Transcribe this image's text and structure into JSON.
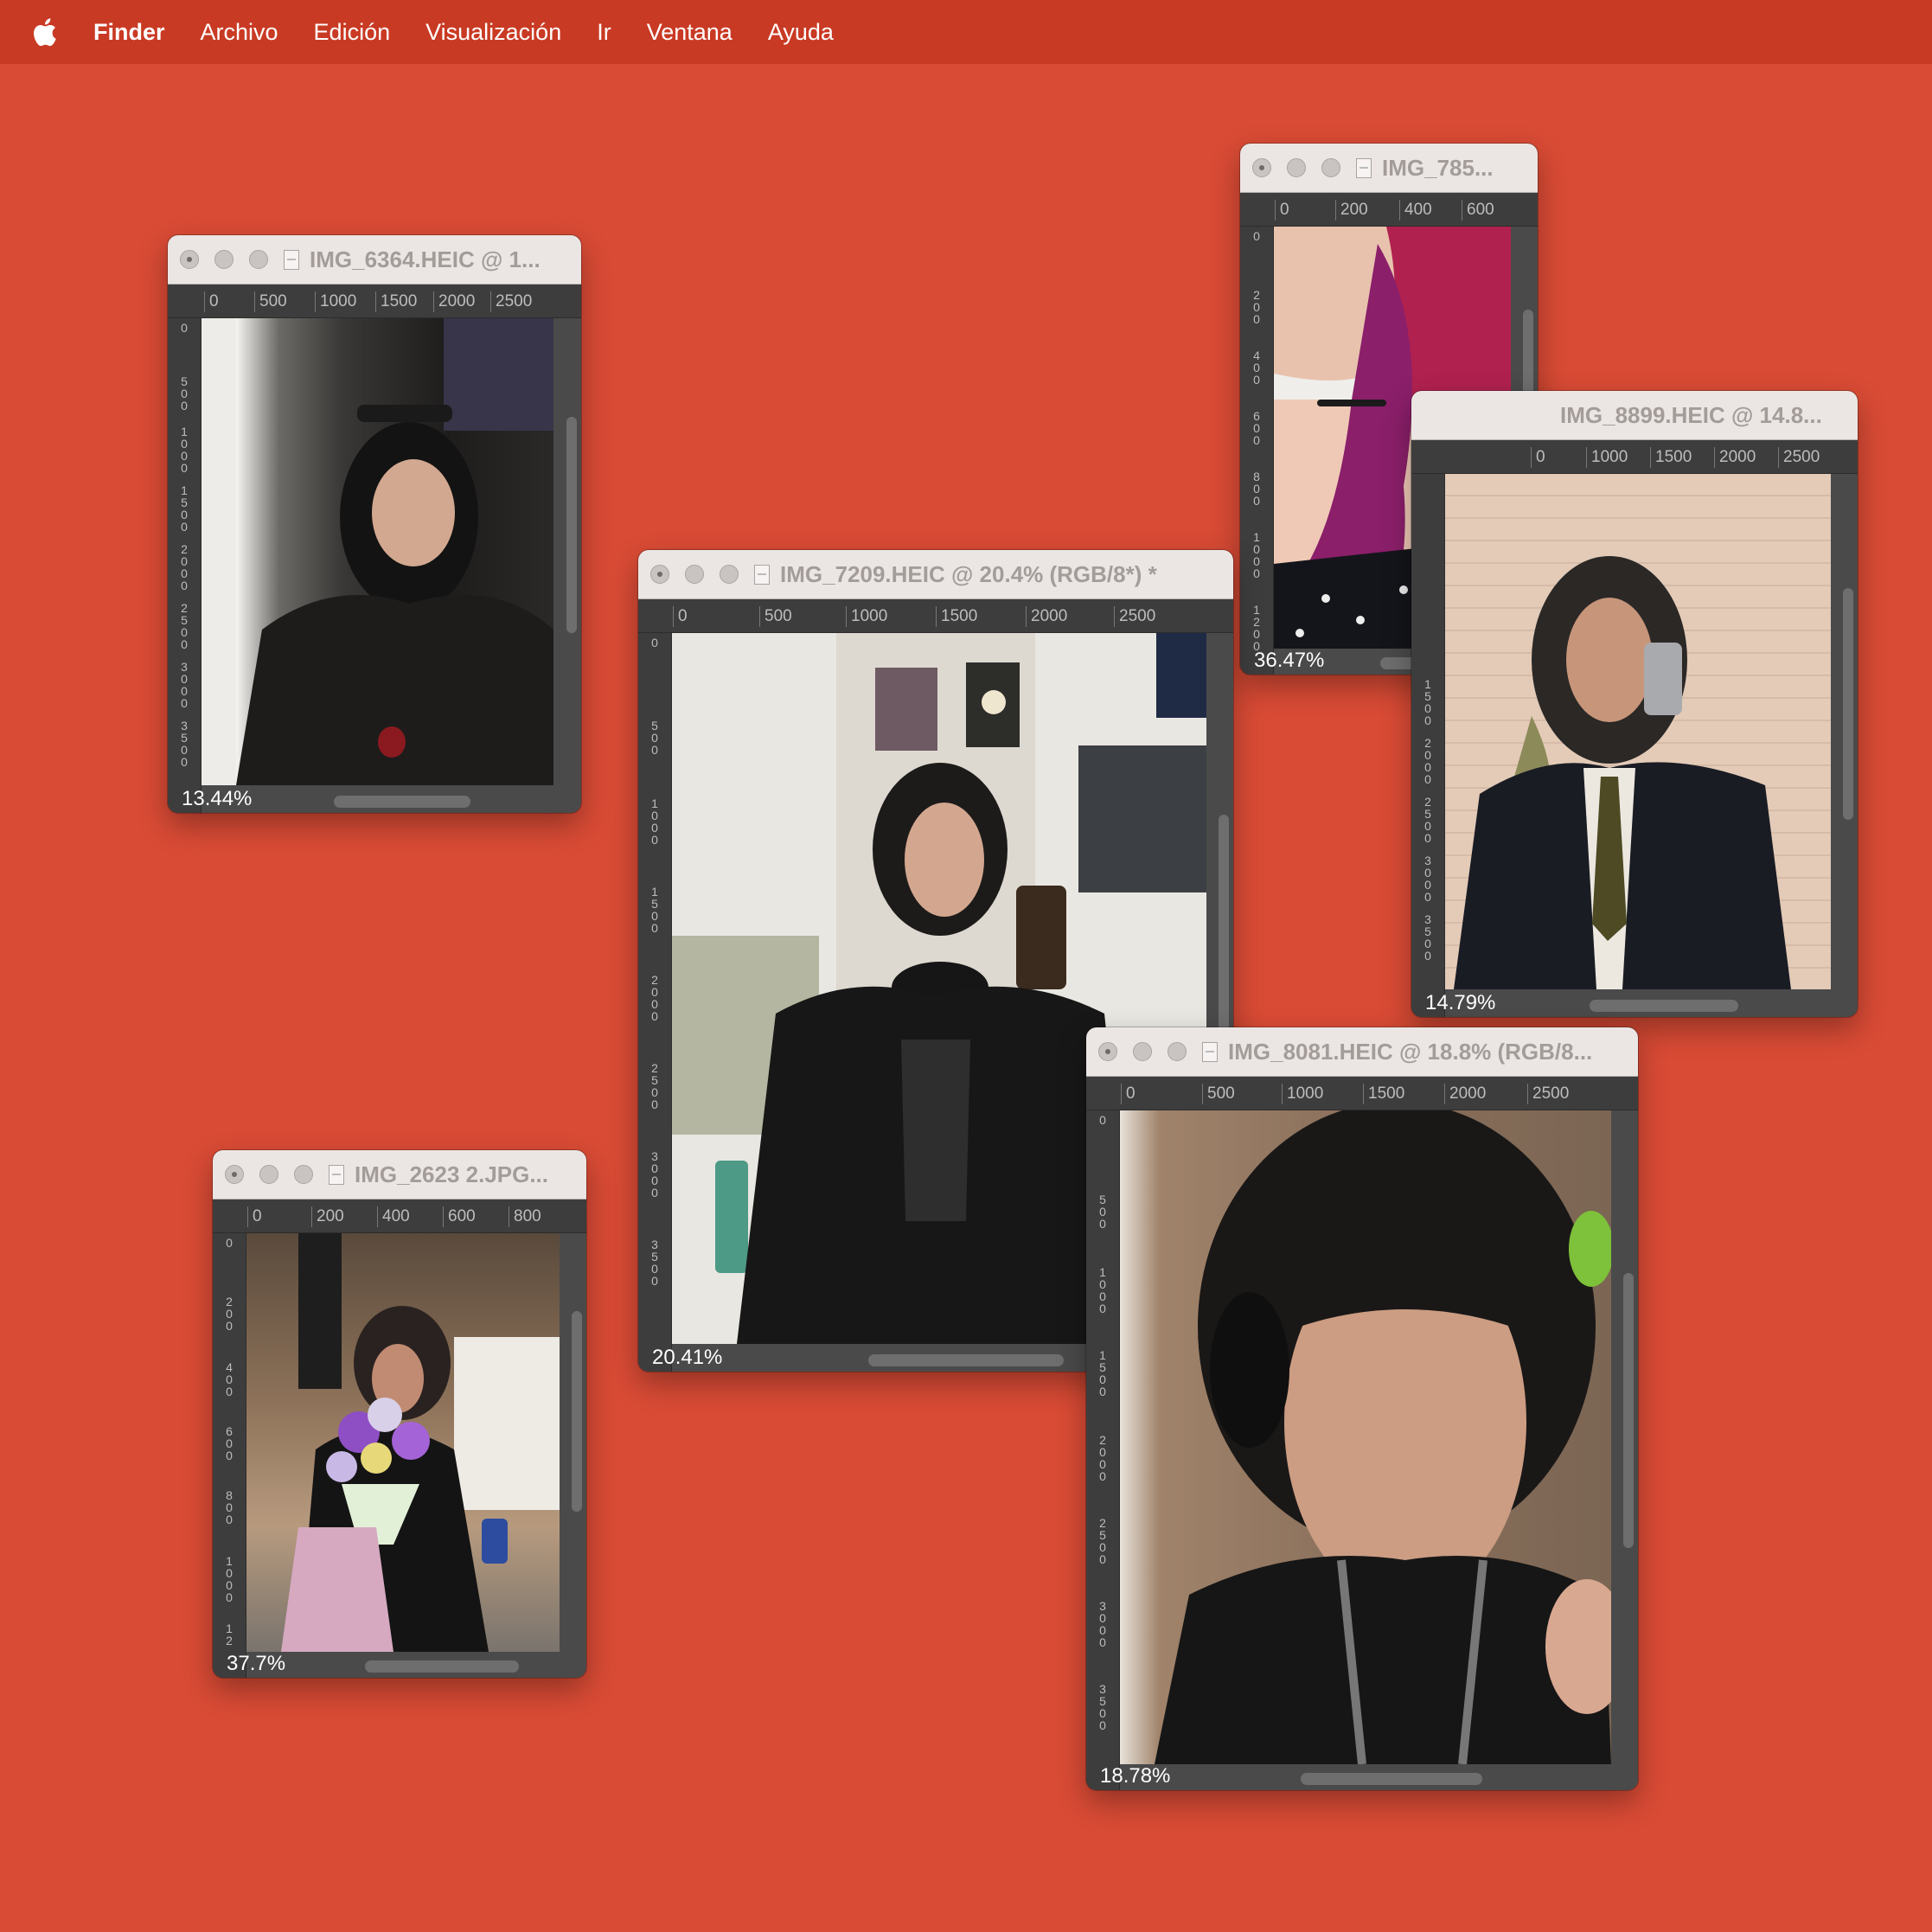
{
  "colors": {
    "desktop": "#d94b35",
    "menubar": "#c93a24",
    "window_chrome": "#4a4a4a",
    "titlebar": "#ebe6e4"
  },
  "menubar": {
    "icon": "apple-logo-icon",
    "app_name": "Finder",
    "items": [
      "Archivo",
      "Edición",
      "Visualización",
      "Ir",
      "Ventana",
      "Ayuda"
    ]
  },
  "windows": [
    {
      "title": "IMG_6364.HEIC @ 1...",
      "zoom": "13.44%",
      "ruler_x": [
        "0",
        "500",
        "1000",
        "1500",
        "2000",
        "2500"
      ],
      "ruler_y": [
        "0",
        "5\n0\n0",
        "1\n0\n0\n0",
        "1\n5\n0\n0",
        "2\n0\n0\n0",
        "2\n5\n0\n0",
        "3\n0\n0\n0",
        "3\n5\n0\n0"
      ]
    },
    {
      "title": "IMG_785...",
      "zoom": "36.47%",
      "ruler_x": [
        "0",
        "200",
        "400",
        "600"
      ],
      "ruler_y": [
        "0",
        "2\n0\n0",
        "4\n0\n0",
        "6\n0\n0",
        "8\n0\n0",
        "1\n0\n0\n0",
        "1\n2\n0\n0"
      ]
    },
    {
      "title": "IMG_8899.HEIC @ 14.8...",
      "zoom": "14.79%",
      "ruler_x": [
        "0",
        "1000",
        "1500",
        "2000",
        "2500"
      ],
      "ruler_y": [
        "1\n5\n0\n0",
        "2\n0\n0\n0",
        "2\n5\n0\n0",
        "3\n0\n0\n0",
        "3\n5\n0\n0"
      ]
    },
    {
      "title": "IMG_7209.HEIC @ 20.4% (RGB/8*) *",
      "zoom": "20.41%",
      "ruler_x": [
        "0",
        "500",
        "1000",
        "1500",
        "2000",
        "2500"
      ],
      "ruler_y": [
        "0",
        "5\n0\n0",
        "1\n0\n0\n0",
        "1\n5\n0\n0",
        "2\n0\n0\n0",
        "2\n5\n0\n0",
        "3\n0\n0\n0",
        "3\n5\n0\n0"
      ]
    },
    {
      "title": "IMG_8081.HEIC @ 18.8% (RGB/8...",
      "zoom": "18.78%",
      "ruler_x": [
        "0",
        "500",
        "1000",
        "1500",
        "2000",
        "2500"
      ],
      "ruler_y": [
        "0",
        "5\n0\n0",
        "1\n0\n0\n0",
        "1\n5\n0\n0",
        "2\n0\n0\n0",
        "2\n5\n0\n0",
        "3\n0\n0\n0",
        "3\n5\n0\n0"
      ]
    },
    {
      "title": "IMG_2623 2.JPG...",
      "zoom": "37.7%",
      "ruler_x": [
        "0",
        "200",
        "400",
        "600",
        "800"
      ],
      "ruler_y": [
        "0",
        "2\n0\n0",
        "4\n0\n0",
        "6\n0\n0",
        "8\n0\n0",
        "1\n0\n0\n0",
        "1\n2"
      ]
    }
  ]
}
